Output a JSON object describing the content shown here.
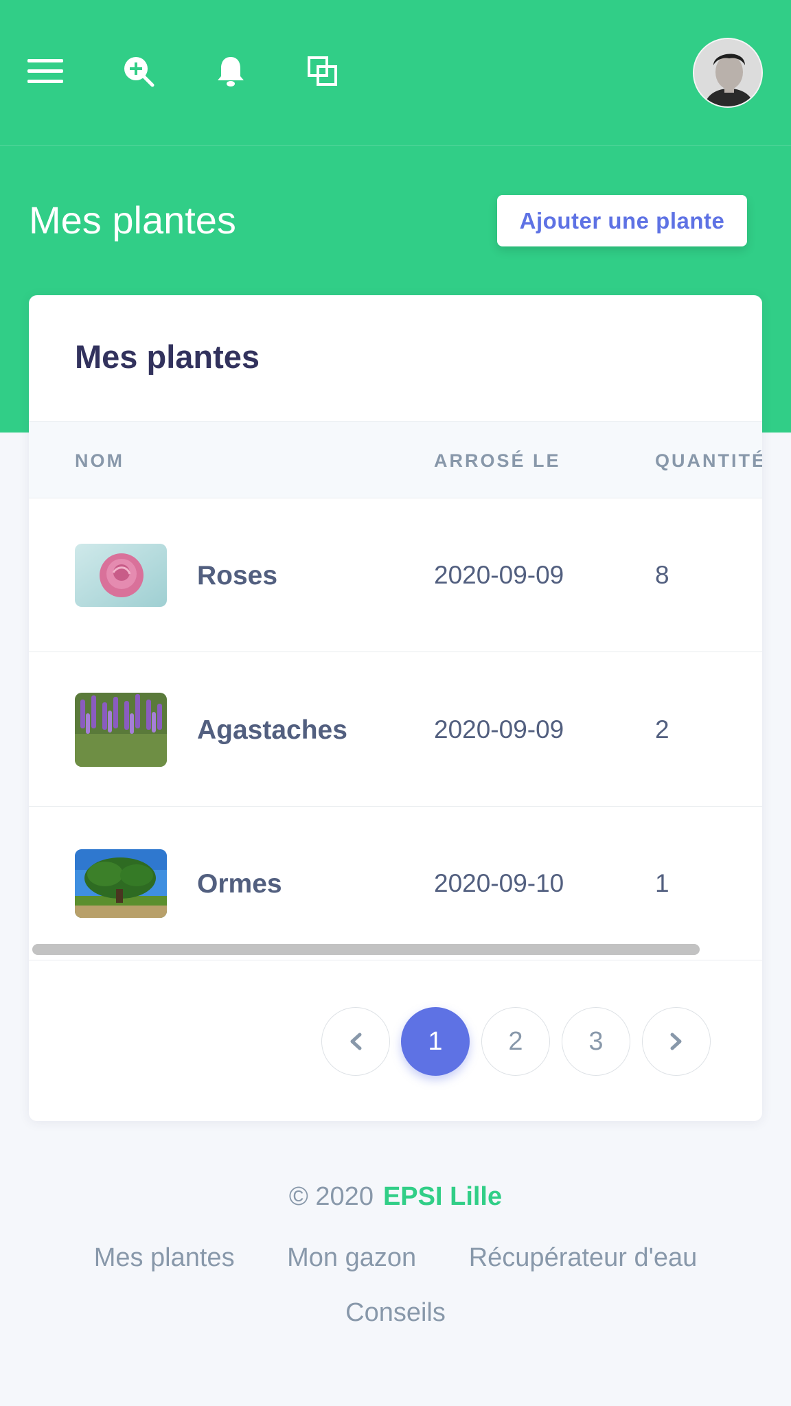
{
  "header": {
    "menu_icon": "hamburger-menu-icon",
    "search_icon": "zoom-in-search-icon",
    "bell_icon": "bell-icon",
    "windows_icon": "copy-windows-icon",
    "avatar_icon": "user-avatar"
  },
  "page": {
    "title": "Mes plantes",
    "add_button": "Ajouter une plante"
  },
  "card": {
    "title": "Mes plantes",
    "columns": [
      "NOM",
      "ARROSÉ LE",
      "QUANTITÉ"
    ],
    "rows": [
      {
        "name": "Roses",
        "watered": "2020-09-09",
        "quantity": "8",
        "image": "pink-rose-photo"
      },
      {
        "name": "Agastaches",
        "watered": "2020-09-09",
        "quantity": "2",
        "image": "purple-agastache-photo"
      },
      {
        "name": "Ormes",
        "watered": "2020-09-10",
        "quantity": "1",
        "image": "elm-tree-photo"
      }
    ]
  },
  "pagination": {
    "prev_icon": "chevron-left-icon",
    "pages": [
      "1",
      "2",
      "3"
    ],
    "active_page": "1",
    "next_icon": "chevron-right-icon"
  },
  "footer": {
    "copyright": "© 2020",
    "brand": "EPSI Lille",
    "links": [
      "Mes plantes",
      "Mon gazon",
      "Récupérateur d'eau",
      "Conseils"
    ]
  },
  "colors": {
    "primary_green": "#31ce87",
    "accent_blue": "#5e72e4",
    "text_dark": "#32325d",
    "text_muted": "#8898aa"
  }
}
